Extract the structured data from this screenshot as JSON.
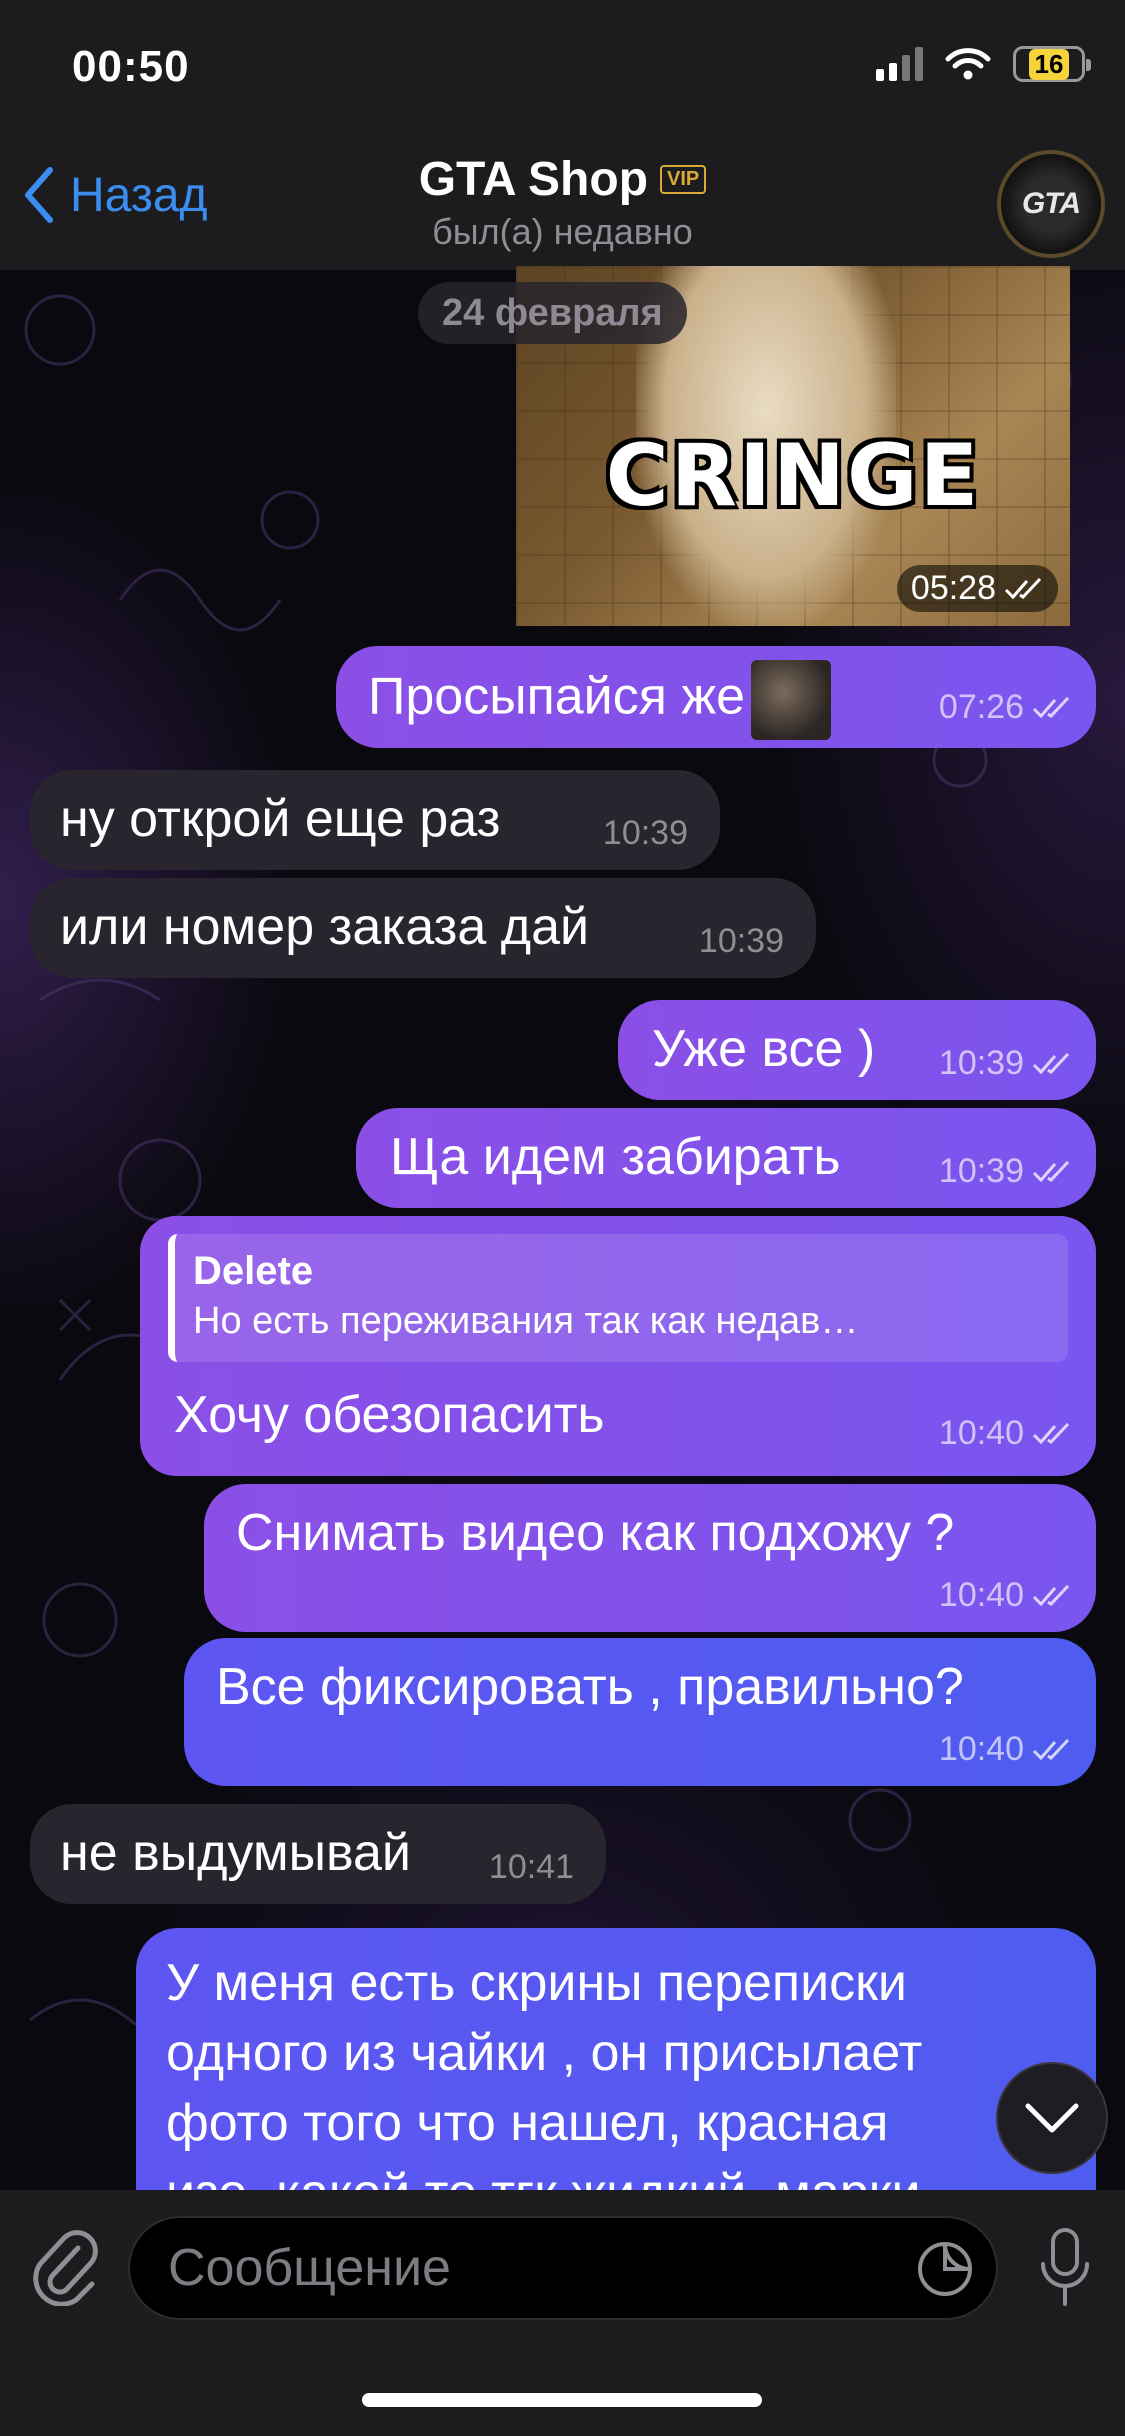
{
  "status_bar": {
    "time": "00:50",
    "battery": "16"
  },
  "header": {
    "back_label": "Назад",
    "title": "GTA Shop",
    "vip_badge": "VIP",
    "subtitle": "был(а) недавно",
    "avatar_text": "GTA"
  },
  "date_pill": "24 февраля",
  "messages": [
    {
      "kind": "photo",
      "overlay_text": "CRINGE",
      "time": "05:28",
      "read": true
    },
    {
      "kind": "out",
      "text": "Просыпайся же",
      "time": "07:26",
      "read": true
    },
    {
      "kind": "in",
      "text": "ну открой еще раз",
      "time": "10:39"
    },
    {
      "kind": "in",
      "text": "или номер заказа дай",
      "time": "10:39"
    },
    {
      "kind": "out",
      "text": "Уже все )",
      "time": "10:39",
      "read": true
    },
    {
      "kind": "out",
      "text": "Ща идем забирать",
      "time": "10:39",
      "read": true
    },
    {
      "kind": "out",
      "reply_to": {
        "name": "Delete",
        "text": "Но есть переживания так как недав…"
      },
      "text": "Хочу обезопасить",
      "time": "10:40",
      "read": true
    },
    {
      "kind": "out",
      "text": "Снимать видео как подхожу ?",
      "time": "10:40",
      "read": true
    },
    {
      "kind": "out",
      "text": "Все фиксировать , правильно?",
      "time": "10:40",
      "read": true
    },
    {
      "kind": "in",
      "text": "не выдумывай",
      "time": "10:41"
    },
    {
      "kind": "out",
      "lines": [
        "У меня есть скрины переписки",
        "одного из чайки , он присылает",
        "фото того что нашел, красная",
        "изо, какой то тгк жидкий, марки"
      ]
    }
  ],
  "input": {
    "placeholder": "Сообщение"
  },
  "colors": {
    "accent": "#3b8df0",
    "outgoing": "#8b4fe6",
    "outgoing_blue": "#4f5cf0",
    "incoming": "#29252e"
  }
}
